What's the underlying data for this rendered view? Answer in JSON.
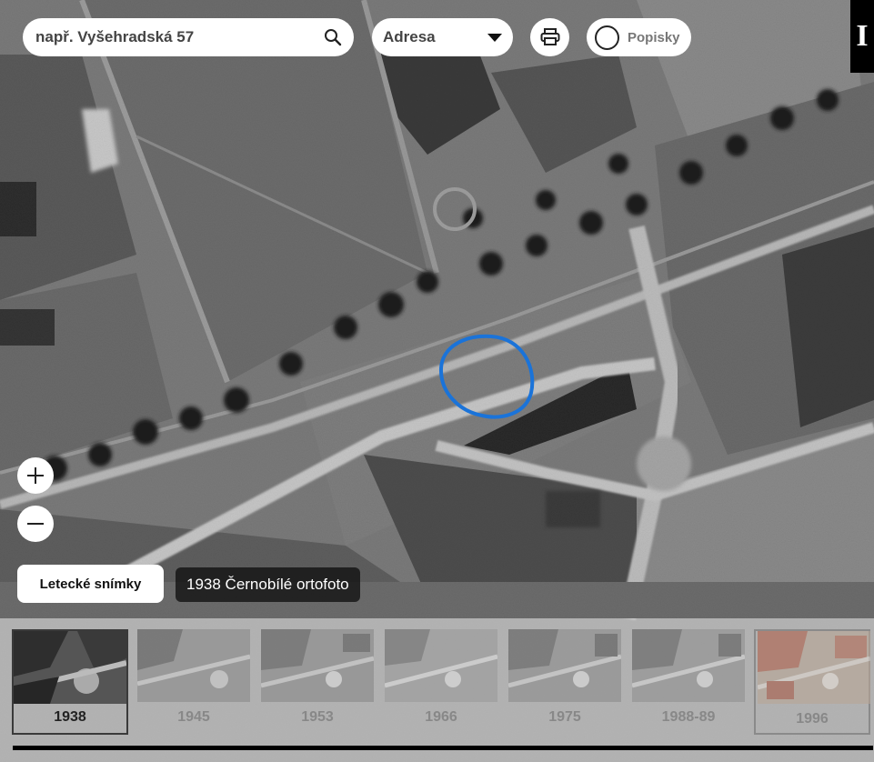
{
  "search": {
    "placeholder": "např. Vyšehradská 57",
    "icon": "search-icon"
  },
  "search_type": {
    "selected": "Adresa",
    "icon": "chevron-down-icon"
  },
  "print": {
    "icon": "printer-icon"
  },
  "labels_toggle": {
    "label": "Popisky",
    "checked": false
  },
  "corner_logo": {
    "text": "I"
  },
  "zoom": {
    "in_icon": "plus-icon",
    "out_icon": "minus-icon"
  },
  "layer": {
    "button_label": "Letecké snímky",
    "current_caption": "1938 Černobílé ortofoto"
  },
  "timeline": {
    "years": [
      "1938",
      "1945",
      "1953",
      "1966",
      "1975",
      "1988-89",
      "1996"
    ],
    "active": "1938"
  },
  "marker": {
    "color": "#1a73d9",
    "shape": "hand-drawn-circle"
  }
}
